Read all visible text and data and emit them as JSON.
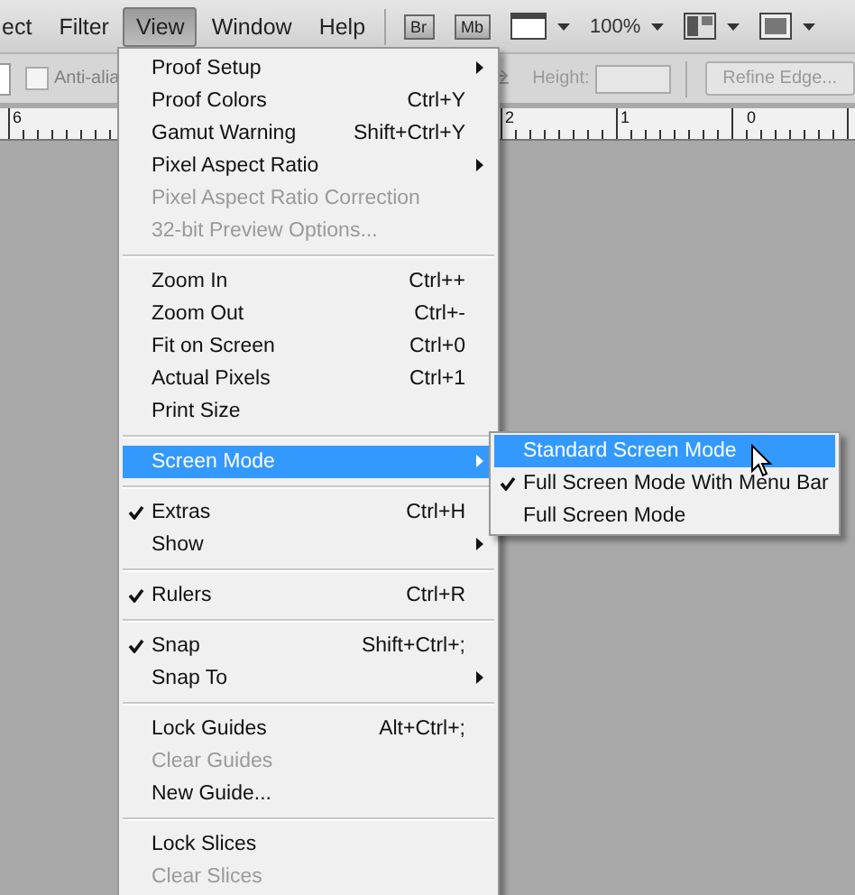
{
  "menu_bar": {
    "items": [
      {
        "label": "ect",
        "selected": false
      },
      {
        "label": "Filter",
        "selected": false
      },
      {
        "label": "View",
        "selected": true
      },
      {
        "label": "Window",
        "selected": false
      },
      {
        "label": "Help",
        "selected": false
      }
    ],
    "bridge_button": "Br",
    "mini_bridge_button": "Mb",
    "zoom": "100%"
  },
  "options_bar": {
    "anti_alias": {
      "label": "Anti-alia",
      "checked": false,
      "disabled": true
    },
    "height_label": "Height:",
    "refine_button": "Refine Edge..."
  },
  "ruler": {
    "labels": [
      "6",
      "2",
      "1",
      "0"
    ]
  },
  "view_menu": {
    "items": [
      {
        "kind": "item",
        "label": "Proof Setup",
        "submenu": true,
        "checked": false,
        "disabled": false,
        "selected": false
      },
      {
        "kind": "item",
        "label": "Proof Colors",
        "shortcut": "Ctrl+Y",
        "submenu": false,
        "checked": false,
        "disabled": false,
        "selected": false
      },
      {
        "kind": "item",
        "label": "Gamut Warning",
        "shortcut": "Shift+Ctrl+Y",
        "submenu": false,
        "checked": false,
        "disabled": false,
        "selected": false
      },
      {
        "kind": "item",
        "label": "Pixel Aspect Ratio",
        "submenu": true,
        "checked": false,
        "disabled": false,
        "selected": false
      },
      {
        "kind": "item",
        "label": "Pixel Aspect Ratio Correction",
        "submenu": false,
        "checked": false,
        "disabled": true,
        "selected": false
      },
      {
        "kind": "item",
        "label": "32-bit Preview Options...",
        "submenu": false,
        "checked": false,
        "disabled": true,
        "selected": false
      },
      {
        "kind": "separator"
      },
      {
        "kind": "item",
        "label": "Zoom In",
        "shortcut": "Ctrl++",
        "submenu": false,
        "checked": false,
        "disabled": false,
        "selected": false
      },
      {
        "kind": "item",
        "label": "Zoom Out",
        "shortcut": "Ctrl+-",
        "submenu": false,
        "checked": false,
        "disabled": false,
        "selected": false
      },
      {
        "kind": "item",
        "label": "Fit on Screen",
        "shortcut": "Ctrl+0",
        "submenu": false,
        "checked": false,
        "disabled": false,
        "selected": false
      },
      {
        "kind": "item",
        "label": "Actual Pixels",
        "shortcut": "Ctrl+1",
        "submenu": false,
        "checked": false,
        "disabled": false,
        "selected": false
      },
      {
        "kind": "item",
        "label": "Print Size",
        "submenu": false,
        "checked": false,
        "disabled": false,
        "selected": false
      },
      {
        "kind": "separator"
      },
      {
        "kind": "item",
        "label": "Screen Mode",
        "submenu": true,
        "checked": false,
        "disabled": false,
        "selected": true
      },
      {
        "kind": "separator"
      },
      {
        "kind": "item",
        "label": "Extras",
        "shortcut": "Ctrl+H",
        "submenu": false,
        "checked": true,
        "disabled": false,
        "selected": false
      },
      {
        "kind": "item",
        "label": "Show",
        "submenu": true,
        "checked": false,
        "disabled": false,
        "selected": false
      },
      {
        "kind": "separator"
      },
      {
        "kind": "item",
        "label": "Rulers",
        "shortcut": "Ctrl+R",
        "submenu": false,
        "checked": true,
        "disabled": false,
        "selected": false
      },
      {
        "kind": "separator"
      },
      {
        "kind": "item",
        "label": "Snap",
        "shortcut": "Shift+Ctrl+;",
        "submenu": false,
        "checked": true,
        "disabled": false,
        "selected": false
      },
      {
        "kind": "item",
        "label": "Snap To",
        "submenu": true,
        "checked": false,
        "disabled": false,
        "selected": false
      },
      {
        "kind": "separator"
      },
      {
        "kind": "item",
        "label": "Lock Guides",
        "shortcut": "Alt+Ctrl+;",
        "submenu": false,
        "checked": false,
        "disabled": false,
        "selected": false
      },
      {
        "kind": "item",
        "label": "Clear Guides",
        "submenu": false,
        "checked": false,
        "disabled": true,
        "selected": false
      },
      {
        "kind": "item",
        "label": "New Guide...",
        "submenu": false,
        "checked": false,
        "disabled": false,
        "selected": false
      },
      {
        "kind": "separator"
      },
      {
        "kind": "item",
        "label": "Lock Slices",
        "submenu": false,
        "checked": false,
        "disabled": false,
        "selected": false
      },
      {
        "kind": "item",
        "label": "Clear Slices",
        "submenu": false,
        "checked": false,
        "disabled": true,
        "selected": false
      }
    ]
  },
  "screen_mode_submenu": {
    "items": [
      {
        "label": "Standard Screen Mode",
        "checked": false,
        "selected": true
      },
      {
        "label": "Full Screen Mode With Menu Bar",
        "checked": true,
        "selected": false
      },
      {
        "label": "Full Screen Mode",
        "checked": false,
        "selected": false
      }
    ]
  }
}
